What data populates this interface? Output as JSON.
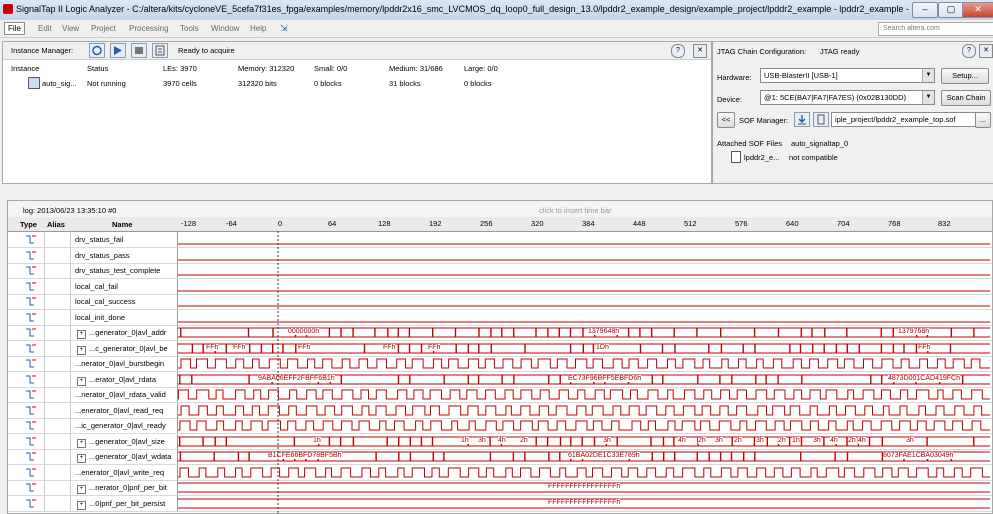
{
  "window": {
    "title": "SignalTap II Logic Analyzer - C:/altera/kits/cycloneVE_5cefa7f31es_fpga/examples/memory/lpddr2x16_smc_LVCMOS_dq_loop0_full_design_13.0/lpddr2_example_design/example_project/lpddr2_example - lpddr2_example - ..."
  },
  "menu": {
    "items": [
      "File",
      "Edit",
      "View",
      "Project",
      "Processing",
      "Tools",
      "Window",
      "Help"
    ],
    "search_placeholder": "Search altera.com"
  },
  "instance_manager": {
    "label": "Instance Manager:",
    "status": "Ready to acquire",
    "headers": {
      "instance": "Instance",
      "status": "Status",
      "les": "LEs: 3970",
      "memory": "Memory: 312320",
      "small": "Small: 0/0",
      "medium": "Medium: 31/686",
      "large": "Large: 0/0"
    },
    "row": {
      "instance": "auto_sig...",
      "status": "Not running",
      "les": "3970 cells",
      "memory": "312320 bits",
      "small": "0 blocks",
      "medium": "31 blocks",
      "large": "0 blocks"
    }
  },
  "jtag": {
    "label": "JTAG Chain Configuration:",
    "status": "JTAG ready",
    "hardware_label": "Hardware:",
    "hardware_value": "USB-BlasterII [USB-1]",
    "setup_button": "Setup...",
    "device_label": "Device:",
    "device_value": "@1: 5CE(BA7|FA7|FA7ES) (0x02B130DD)",
    "scan_button": "Scan Chain",
    "prev_button": "<<",
    "sof_label": "SOF Manager:",
    "sof_path": "iple_project/lpddr2_example_top.sof",
    "sof_browse": "...",
    "attached_label": "Attached SOF Files",
    "attached_value": "auto_signaltap_0",
    "file_name": "lpddr2_e...",
    "file_status": "not compatible"
  },
  "waveform": {
    "log": "log: 2013/06/23 13:35:10  #0",
    "insert_hint": "click to insert time bar",
    "col_type": "Type",
    "col_alias": "Alias",
    "col_name": "Name",
    "ticks": [
      "-128",
      "-64",
      "0",
      "64",
      "128",
      "192",
      "256",
      "320",
      "384",
      "448",
      "512",
      "576",
      "640",
      "704",
      "768",
      "832"
    ],
    "signals": [
      {
        "name": "drv_status_fail",
        "bus": false,
        "values": []
      },
      {
        "name": "drv_status_pass",
        "bus": false,
        "values": []
      },
      {
        "name": "drv_status_test_complete",
        "bus": false,
        "values": []
      },
      {
        "name": "local_cal_fail",
        "bus": false,
        "values": []
      },
      {
        "name": "local_cal_success",
        "bus": false,
        "values": []
      },
      {
        "name": "local_init_done",
        "bus": false,
        "values": []
      },
      {
        "name": "...generator_0|avl_addr",
        "bus": true,
        "values": [
          "0000000h",
          "1379648h",
          "1379768h"
        ]
      },
      {
        "name": "...c_generator_0|avl_be",
        "bus": true,
        "values": [
          "FFh",
          "FFh",
          "FFh",
          "FFh",
          "FFh",
          "1Dh",
          "FFh"
        ]
      },
      {
        "name": "...nerator_0|avl_burstbegin",
        "bus": false,
        "values": []
      },
      {
        "name": "...erator_0|avl_rdata",
        "bus": true,
        "values": [
          "9ABA06EFF2FBFF6B1h",
          "EC73F96BFF5EBFD6h",
          "4873D001CAD419FCh"
        ]
      },
      {
        "name": "...nerator_0|avl_rdata_valid",
        "bus": false,
        "values": []
      },
      {
        "name": "...enerator_0|avl_read_req",
        "bus": false,
        "values": []
      },
      {
        "name": "...ic_generator_0|avl_ready",
        "bus": false,
        "values": []
      },
      {
        "name": "...generator_0|avl_size",
        "bus": true,
        "values": [
          "1h",
          "1h",
          "3h",
          "4h",
          "2h",
          "3h",
          "4h",
          "2h",
          "3h",
          "2h",
          "3h",
          "2h",
          "1h",
          "3h",
          "4h",
          "2h",
          "3h",
          "4h"
        ]
      },
      {
        "name": "...generator_0|avl_wdata",
        "bus": true,
        "values": [
          "B1CFE66BFD78BF5Bh",
          "61BA02DE1C33E789h",
          "8073FAE1CBA03049h"
        ]
      },
      {
        "name": "...enerator_0|avl_write_req",
        "bus": false,
        "values": []
      },
      {
        "name": "...nerator_0|pnf_per_bit",
        "bus": true,
        "values": [
          "FFFFFFFFFFFFFFFFh"
        ]
      },
      {
        "name": "...0|pnf_per_bit_persist",
        "bus": true,
        "values": [
          "FFFFFFFFFFFFFFFFh"
        ]
      }
    ]
  },
  "colors": {
    "wave": "#c00000",
    "accent": "#1f5fa8"
  }
}
